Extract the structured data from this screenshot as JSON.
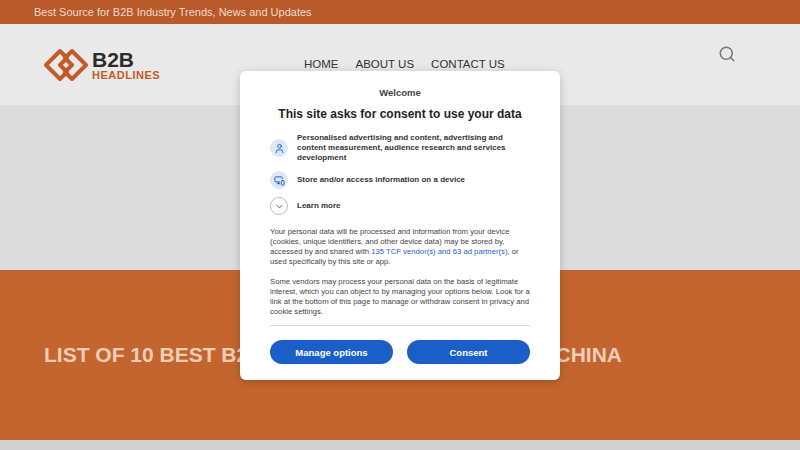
{
  "top_bar": {
    "tagline": "Best Source for B2B Industry Trends, News and Updates"
  },
  "logo": {
    "top": "B2B",
    "bottom": "HEADLINES"
  },
  "nav": [
    {
      "label": "HOME"
    },
    {
      "label": "ABOUT US"
    },
    {
      "label": "CONTACT US"
    }
  ],
  "hero": {
    "title_start": "LIST OF 10 BEST B2",
    "title_end": "CHINA"
  },
  "consent": {
    "eyebrow": "Welcome",
    "title": "This site asks for consent to use your data",
    "purposes": [
      {
        "label": "Personalised advertising and content, advertising and content measurement, audience research and services development",
        "kind": "person"
      },
      {
        "label": "Store and/or access information on a device",
        "kind": "device"
      }
    ],
    "learn_more": {
      "label": "Learn more",
      "expanded": false
    },
    "notice": {
      "before": "Your personal data will be processed and information from your device (cookies, unique identifiers, and other device data) may be stored by, accessed by and shared with ",
      "link": "135 TCF vendor(s) and 63 ad partner(s)",
      "after": ", or used specifically by this site or app."
    },
    "legitimate_interest": "Some vendors may process your personal data on the basis of legitimate interest, which you can object to by managing your options below. Look for a link at the bottom of this page to manage or withdraw consent in privacy and cookie settings.",
    "buttons": [
      {
        "label": "Manage options"
      },
      {
        "label": "Consent"
      }
    ]
  }
}
